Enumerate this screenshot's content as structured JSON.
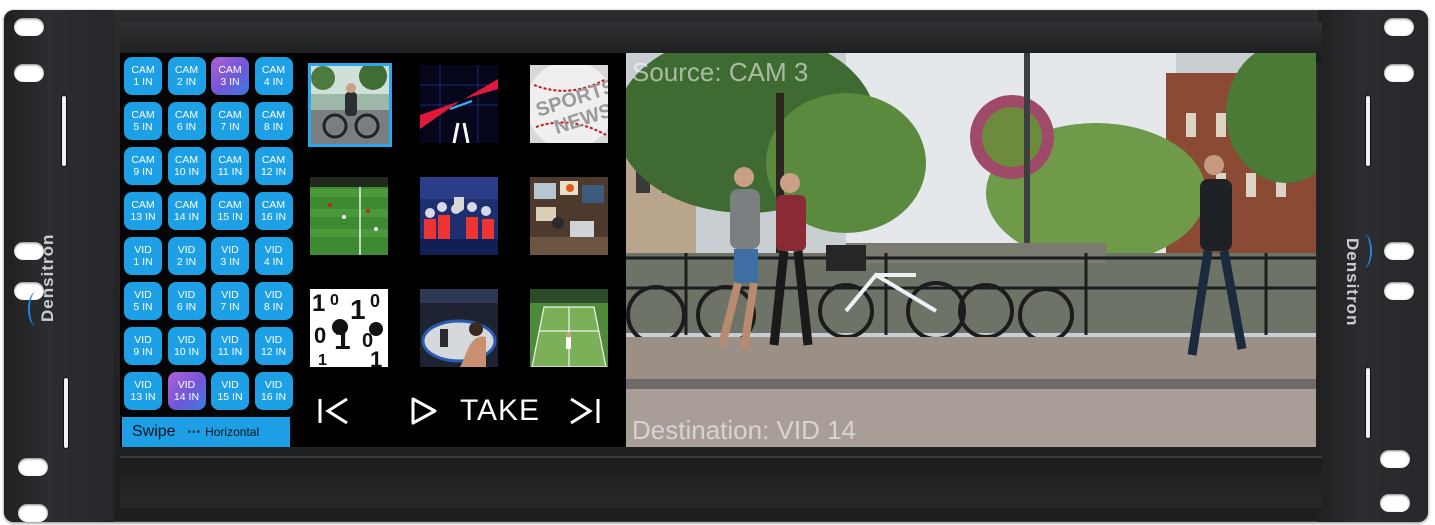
{
  "brand": "Densitron",
  "buttons": [
    {
      "line1": "CAM",
      "line2": "1 IN",
      "selected": false
    },
    {
      "line1": "CAM",
      "line2": "2 IN",
      "selected": false
    },
    {
      "line1": "CAM",
      "line2": "3 IN",
      "selected": true
    },
    {
      "line1": "CAM",
      "line2": "4 IN",
      "selected": false
    },
    {
      "line1": "CAM",
      "line2": "5 IN",
      "selected": false
    },
    {
      "line1": "CAM",
      "line2": "6 IN",
      "selected": false
    },
    {
      "line1": "CAM",
      "line2": "7 IN",
      "selected": false
    },
    {
      "line1": "CAM",
      "line2": "8 IN",
      "selected": false
    },
    {
      "line1": "CAM",
      "line2": "9 IN",
      "selected": false
    },
    {
      "line1": "CAM",
      "line2": "10 IN",
      "selected": false
    },
    {
      "line1": "CAM",
      "line2": "11 IN",
      "selected": false
    },
    {
      "line1": "CAM",
      "line2": "12 IN",
      "selected": false
    },
    {
      "line1": "CAM",
      "line2": "13 IN",
      "selected": false
    },
    {
      "line1": "CAM",
      "line2": "14 IN",
      "selected": false
    },
    {
      "line1": "CAM",
      "line2": "15 IN",
      "selected": false
    },
    {
      "line1": "CAM",
      "line2": "16 IN",
      "selected": false
    },
    {
      "line1": "VID",
      "line2": "1 IN",
      "selected": false
    },
    {
      "line1": "VID",
      "line2": "2 IN",
      "selected": false
    },
    {
      "line1": "VID",
      "line2": "3 IN",
      "selected": false
    },
    {
      "line1": "VID",
      "line2": "4 IN",
      "selected": false
    },
    {
      "line1": "VID",
      "line2": "5 IN",
      "selected": false
    },
    {
      "line1": "VID",
      "line2": "6 IN",
      "selected": false
    },
    {
      "line1": "VID",
      "line2": "7 IN",
      "selected": false
    },
    {
      "line1": "VID",
      "line2": "8 IN",
      "selected": false
    },
    {
      "line1": "VID",
      "line2": "9 IN",
      "selected": false
    },
    {
      "line1": "VID",
      "line2": "10 IN",
      "selected": false
    },
    {
      "line1": "VID",
      "line2": "11 IN",
      "selected": false
    },
    {
      "line1": "VID",
      "line2": "12 IN",
      "selected": false
    },
    {
      "line1": "VID",
      "line2": "13 IN",
      "selected": false
    },
    {
      "line1": "VID",
      "line2": "14 IN",
      "selected": true
    },
    {
      "line1": "VID",
      "line2": "15 IN",
      "selected": false
    },
    {
      "line1": "VID",
      "line2": "16 IN",
      "selected": false
    }
  ],
  "swipe": {
    "label": "Swipe",
    "dots": "•••",
    "mode": "Horizontal"
  },
  "thumbnails": [
    {
      "name": "cyclist-street",
      "active": true
    },
    {
      "name": "neon-tunnel",
      "active": false
    },
    {
      "name": "sports-news",
      "active": false,
      "text": "SPORTS NEWS"
    },
    {
      "name": "football-pitch",
      "active": false
    },
    {
      "name": "trophy-celebration",
      "active": false
    },
    {
      "name": "newsroom",
      "active": false
    },
    {
      "name": "numbers-pattern",
      "active": false
    },
    {
      "name": "fight-arena",
      "active": false
    },
    {
      "name": "tennis-court",
      "active": false
    }
  ],
  "controls": {
    "first": "|<",
    "play": "▷",
    "take": "TAKE",
    "last": ">|"
  },
  "preview": {
    "source": "Source: CAM 3",
    "destination": "Destination: VID 14"
  },
  "colors": {
    "button": "#1ea0e6",
    "selected_start": "#b05fd6",
    "selected_end": "#3b7be0",
    "active_border": "#29a8ee"
  }
}
